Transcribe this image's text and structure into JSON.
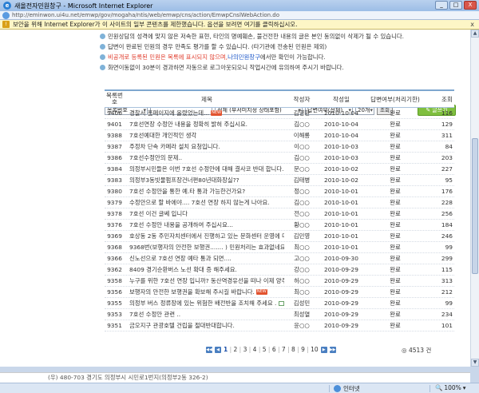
{
  "window": {
    "title": "새올전자민원창구 - Microsoft Internet Explorer",
    "minimize": "_",
    "maximize": "□",
    "close": "X"
  },
  "address": {
    "url": "http://eminwon.ui4u.net/emwp/gov/mogaha/ntis/web/emwp/cns/action/EmwpCnslWebAction.do"
  },
  "infobar": {
    "text": "보안을 위해 Internet Explorer가 이 사이트의 일부 콘텐츠를 제한했습니다. 옵션을 보려면 여기를 클릭하십시오.",
    "close": "x"
  },
  "notice": {
    "line1": "민원상담의 성격에 맞지 않은 저속한 표현, 타인의 명예훼손, 불건전한 내용의 글은 본인 동의없이 삭제가 될 수 있습니다.",
    "line2": "답변이 완료된 민원의 경우 만족도 평가를 할 수 있습니다. (타기관에 전송된 민원은 제외)",
    "line3_red": "비공개로 등록된 민원은 목록에 표시되지 않으며, ",
    "line3_blue": "나의민원창구",
    "line3_rest": "에서만 확인이 가능합니다.",
    "line4": "화면이동없이 30분이 경과하면 자동으로 로그아웃되오니 작업시간에 유의하여 주시기 바랍니다."
  },
  "filter": {
    "search_type": "목록번호",
    "scope": "전체 (부서미지정 상태포함)",
    "answer_type": "답변여부(전체)",
    "page_size": "20개",
    "lookup": "조회",
    "write": "글쓰기"
  },
  "table": {
    "headers": {
      "no": "목록번호",
      "title": "제목",
      "author": "작성자",
      "date": "작성일",
      "answer": "답변여부(처리기한)",
      "views": "조회"
    },
    "rows": [
      {
        "no": "9406",
        "title": "경찰서 홈페이지에 올렸었는데...",
        "new": "NEW",
        "author": "김영환",
        "date": "2010-10-04",
        "answer": "완료",
        "views": "116"
      },
      {
        "no": "9401",
        "title": "7호선연장 수정안 내용을 정확히 밝혀 주십시요.",
        "author": "김○○",
        "date": "2010-10-04",
        "answer": "완료",
        "views": "129"
      },
      {
        "no": "9388",
        "title": "7호선예대한 개인적인 생각",
        "author": "이해룡",
        "date": "2010-10-04",
        "answer": "완료",
        "views": "311"
      },
      {
        "no": "9387",
        "title": "주정차 단속 카메라 설치 요청입니다.",
        "author": "이○○",
        "date": "2010-10-03",
        "answer": "완료",
        "views": "84"
      },
      {
        "no": "9386",
        "title": "7호선수정안의 문제..",
        "author": "김○○",
        "date": "2010-10-03",
        "answer": "완료",
        "views": "203"
      },
      {
        "no": "9384",
        "title": "의정부시민들은 이번 7호선 수정안에 대해 결사코 반대 합니다.",
        "author": "문○○",
        "date": "2010-10-02",
        "answer": "완료",
        "views": "227"
      },
      {
        "no": "9383",
        "title": "의정부3동빗물펌프장건너편80년대화장실??",
        "author": "김태병",
        "date": "2010-10-02",
        "answer": "완료",
        "views": "95"
      },
      {
        "no": "9380",
        "title": "7호선 수정안을 통한 예.타 통과 가능한건가요?",
        "author": "정○○",
        "date": "2010-10-01",
        "answer": "완료",
        "views": "176"
      },
      {
        "no": "9379",
        "title": "수정안으로 할 바에야.... 7호선 연장 하지 않는게 나아요.",
        "author": "김○○",
        "date": "2010-10-01",
        "answer": "완료",
        "views": "228"
      },
      {
        "no": "9378",
        "title": "7호선 이건 글쎄 입니다",
        "author": "전○○",
        "date": "2010-10-01",
        "answer": "완료",
        "views": "256"
      },
      {
        "no": "9376",
        "title": "7호선 수정안 내용을 공개하여 주십시요...",
        "author": "황○○",
        "date": "2010-10-01",
        "answer": "완료",
        "views": "184"
      },
      {
        "no": "9369",
        "title": "호상동 2동 주민자치센터에서 진행하고 있는 문화센터 운영에 대한 민원",
        "author": "김민영",
        "date": "2010-10-01",
        "answer": "완료",
        "views": "246"
      },
      {
        "no": "9368",
        "title": "9368번(보행자의 안전한 보행권....... ) 민원처리는 효과없네요..",
        "author": "최○○",
        "date": "2010-10-01",
        "answer": "완료",
        "views": "99"
      },
      {
        "no": "9366",
        "title": "신노선으로 7호선 연장 예타 통과 되면....",
        "author": "고○○",
        "date": "2010-09-30",
        "answer": "완료",
        "views": "299"
      },
      {
        "no": "9362",
        "title": "8409 경기순환버스 노선 확대 증 해주세요.",
        "author": "강○○",
        "date": "2010-09-29",
        "answer": "완료",
        "views": "115"
      },
      {
        "no": "9358",
        "title": "누구를 위한 7호선 연장 입니까? 동산역경유선을 떠나 이제 양주연장선 마저 포기하다니요??",
        "author": "허○○",
        "date": "2010-09-29",
        "answer": "완료",
        "views": "313"
      },
      {
        "no": "9356",
        "title": "보행자의 안전한 보행권을 확보해 주시길 바랍니다.",
        "new": "NEW",
        "author": "최○○",
        "date": "2010-09-29",
        "answer": "완료",
        "views": "212"
      },
      {
        "no": "9355",
        "title": "의정부 버스 정류장에 있는 위험한 배전반을 조치해 주세요 ...",
        "attach": "file",
        "author": "김성민",
        "date": "2010-09-29",
        "answer": "완료",
        "views": "99"
      },
      {
        "no": "9353",
        "title": "7호선 수정안 관련 ..",
        "author": "최성열",
        "date": "2010-09-29",
        "answer": "완료",
        "views": "234"
      },
      {
        "no": "9351",
        "title": "금오지구 관광호텔 건립을 절대반대합니다.",
        "author": "윤○○",
        "date": "2010-09-29",
        "answer": "완료",
        "views": "101"
      }
    ]
  },
  "pager": {
    "pages": [
      "1",
      "2",
      "3",
      "4",
      "5",
      "6",
      "7",
      "8",
      "9",
      "10"
    ],
    "current": "1",
    "total": "4513 건",
    "total_icon": "◎"
  },
  "footer": {
    "address": "(우) 480-703 경기도 의정부시 시민로1번지(의정부2동 326-2)"
  },
  "status": {
    "zone": "인터넷",
    "zoom": "100%"
  }
}
